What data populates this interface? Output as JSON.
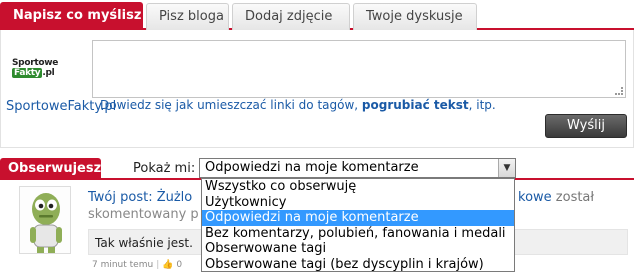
{
  "tabs": [
    {
      "label": "Napisz co myślisz",
      "active": true
    },
    {
      "label": "Pisz bloga",
      "active": false
    },
    {
      "label": "Dodaj zdjęcie",
      "active": false
    },
    {
      "label": "Twoje dyskusje",
      "active": false
    }
  ],
  "composer": {
    "logo_text_a": "Sportowe",
    "logo_text_b": "Fakty",
    "logo_text_c": ".pl",
    "source_link": "SportoweFakty.pl",
    "hint_prefix": "Dowiedz się jak umieszczać linki do tagów, ",
    "hint_bold": "pogrubiać tekst",
    "hint_suffix": ", itp.",
    "send_label": "Wyślij"
  },
  "feed": {
    "section_title": "Obserwujesz",
    "show_label": "Pokaż mi:",
    "selected_filter": "Odpowiedzi na moje komentarze",
    "filter_options": [
      "Wszystko co obserwuję",
      "Użytkownicy",
      "Odpowiedzi na moje komentarze",
      "Bez komentarzy, polubień, fanowania i medali",
      "Obserwowane tagi",
      "Obserwowane tagi (bez dyscyplin i krajów)"
    ],
    "highlighted_index": 2
  },
  "post": {
    "title": "Twój post: Żużlo",
    "title_right_link": "kowe",
    "title_right_grey": " został",
    "subtitle": "skomentowany p",
    "comment": "Tak właśnie jest.",
    "time": "7 minut temu",
    "likes": "0"
  },
  "colors": {
    "brand_red": "#c8102e",
    "link_blue": "#1a5aa6",
    "highlight_blue": "#3399ff"
  }
}
